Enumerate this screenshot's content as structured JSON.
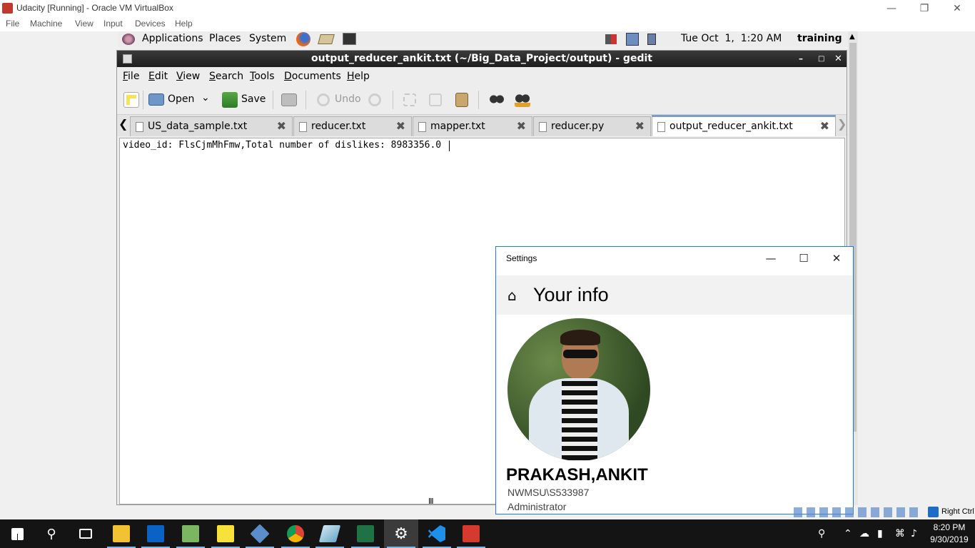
{
  "vbox": {
    "title": "Udacity [Running] - Oracle VM VirtualBox",
    "menu": [
      "File",
      "Machine",
      "View",
      "Input",
      "Devices",
      "Help"
    ],
    "status_host_key": "Right Ctrl"
  },
  "gnome_panel": {
    "menus": [
      "Applications",
      "Places",
      "System"
    ],
    "datetime": "Tue Oct  1,  1:20 AM",
    "user": "training"
  },
  "gedit": {
    "title": "output_reducer_ankit.txt (~/Big_Data_Project/output) - gedit",
    "menu": [
      "File",
      "Edit",
      "View",
      "Search",
      "Tools",
      "Documents",
      "Help"
    ],
    "toolbar": {
      "open_label": "Open",
      "save_label": "Save",
      "undo_label": "Undo"
    },
    "tabs": [
      {
        "label": "US_data_sample.txt",
        "active": false
      },
      {
        "label": "reducer.txt",
        "active": false
      },
      {
        "label": "mapper.txt",
        "active": false
      },
      {
        "label": "reducer.py",
        "active": false
      },
      {
        "label": "output_reducer_ankit.txt",
        "active": true
      }
    ],
    "content": "video_id: FlsCjmMhFmw,Total number of dislikes: 8983356.0"
  },
  "settings": {
    "window_title": "Settings",
    "page_title": "Your info",
    "user_name": "PRAKASH,ANKIT",
    "account": "NWMSU\\S533987",
    "role": "Administrator"
  },
  "taskbar": {
    "time": "8:20 PM",
    "date": "9/30/2019",
    "apps": [
      "file-explorer",
      "outlook",
      "notepad-editor",
      "sticky-notes",
      "virtualbox",
      "chrome",
      "remote-desktop",
      "excel",
      "settings",
      "vscode",
      "terminal-app"
    ],
    "active_app": "settings"
  },
  "colors": {
    "gedit_titlebar": "#2a2a2a",
    "settings_border": "#1e7bd6",
    "taskbar": "#141414",
    "active_tab_accent": "#7a9ec9"
  }
}
